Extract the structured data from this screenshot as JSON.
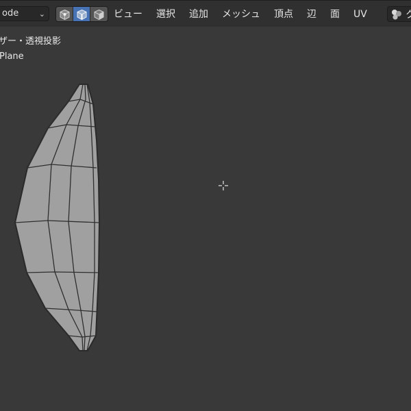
{
  "header": {
    "mode_label": "ode",
    "select_modes": [
      "vertex-select",
      "edge-select",
      "face-select"
    ],
    "active_select_mode": "edge-select",
    "menu": [
      "ビュー",
      "選択",
      "追加",
      "メッシュ",
      "頂点",
      "辺",
      "面",
      "UV"
    ],
    "shading_label": "ク"
  },
  "viewport": {
    "view_label": "ザー・透視投影",
    "object_label": "Plane"
  },
  "colors": {
    "background": "#393939",
    "header": "#303030",
    "mesh_face": "#a0a0a0",
    "mesh_edge": "#2a2a2a",
    "active_button": "#4772b3"
  }
}
